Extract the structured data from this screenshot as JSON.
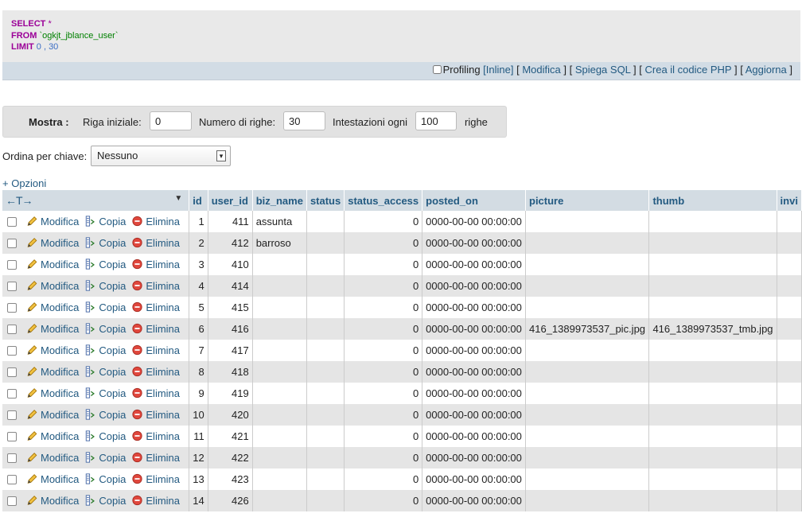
{
  "sql": {
    "select_kw": "SELECT",
    "star": "*",
    "from_kw": "FROM",
    "table": "`ogkjt_jblance_user`",
    "limit_kw": "LIMIT",
    "limit_vals": "0 , 30"
  },
  "sqlbar": {
    "profiling_label": "Profiling",
    "inline": "[Inline]",
    "modifica": "Modifica",
    "spiega": "Spiega SQL",
    "crea": "Crea il codice PHP",
    "aggiorna": "Aggiorna"
  },
  "nav": {
    "mostra": "Mostra :",
    "riga_label": "Riga iniziale:",
    "riga_value": "0",
    "numero_label": "Numero di righe:",
    "numero_value": "30",
    "intestazioni_label": "Intestazioni ogni",
    "intestazioni_value": "100",
    "righe": "righe"
  },
  "ordina": {
    "label": "Ordina per chiave:",
    "value": "Nessuno"
  },
  "opzioni": "+ Opzioni",
  "table": {
    "arrows": "←T→",
    "columns": [
      "id",
      "user_id",
      "biz_name",
      "status",
      "status_access",
      "posted_on",
      "picture",
      "thumb",
      "invi"
    ],
    "actions": {
      "edit": "Modifica",
      "copy": "Copia",
      "delete": "Elimina"
    },
    "rows": [
      {
        "id": "1",
        "user_id": "411",
        "biz_name": "assunta",
        "status": "",
        "status_access": "0",
        "posted_on": "0000-00-00 00:00:00",
        "picture": "",
        "thumb": ""
      },
      {
        "id": "2",
        "user_id": "412",
        "biz_name": "barroso",
        "status": "",
        "status_access": "0",
        "posted_on": "0000-00-00 00:00:00",
        "picture": "",
        "thumb": ""
      },
      {
        "id": "3",
        "user_id": "410",
        "biz_name": "",
        "status": "",
        "status_access": "0",
        "posted_on": "0000-00-00 00:00:00",
        "picture": "",
        "thumb": ""
      },
      {
        "id": "4",
        "user_id": "414",
        "biz_name": "",
        "status": "",
        "status_access": "0",
        "posted_on": "0000-00-00 00:00:00",
        "picture": "",
        "thumb": ""
      },
      {
        "id": "5",
        "user_id": "415",
        "biz_name": "",
        "status": "",
        "status_access": "0",
        "posted_on": "0000-00-00 00:00:00",
        "picture": "",
        "thumb": ""
      },
      {
        "id": "6",
        "user_id": "416",
        "biz_name": "",
        "status": "",
        "status_access": "0",
        "posted_on": "0000-00-00 00:00:00",
        "picture": "416_1389973537_pic.jpg",
        "thumb": "416_1389973537_tmb.jpg"
      },
      {
        "id": "7",
        "user_id": "417",
        "biz_name": "",
        "status": "",
        "status_access": "0",
        "posted_on": "0000-00-00 00:00:00",
        "picture": "",
        "thumb": ""
      },
      {
        "id": "8",
        "user_id": "418",
        "biz_name": "",
        "status": "",
        "status_access": "0",
        "posted_on": "0000-00-00 00:00:00",
        "picture": "",
        "thumb": ""
      },
      {
        "id": "9",
        "user_id": "419",
        "biz_name": "",
        "status": "",
        "status_access": "0",
        "posted_on": "0000-00-00 00:00:00",
        "picture": "",
        "thumb": ""
      },
      {
        "id": "10",
        "user_id": "420",
        "biz_name": "",
        "status": "",
        "status_access": "0",
        "posted_on": "0000-00-00 00:00:00",
        "picture": "",
        "thumb": ""
      },
      {
        "id": "11",
        "user_id": "421",
        "biz_name": "",
        "status": "",
        "status_access": "0",
        "posted_on": "0000-00-00 00:00:00",
        "picture": "",
        "thumb": ""
      },
      {
        "id": "12",
        "user_id": "422",
        "biz_name": "",
        "status": "",
        "status_access": "0",
        "posted_on": "0000-00-00 00:00:00",
        "picture": "",
        "thumb": ""
      },
      {
        "id": "13",
        "user_id": "423",
        "biz_name": "",
        "status": "",
        "status_access": "0",
        "posted_on": "0000-00-00 00:00:00",
        "picture": "",
        "thumb": ""
      },
      {
        "id": "14",
        "user_id": "426",
        "biz_name": "",
        "status": "",
        "status_access": "0",
        "posted_on": "0000-00-00 00:00:00",
        "picture": "",
        "thumb": ""
      }
    ]
  }
}
